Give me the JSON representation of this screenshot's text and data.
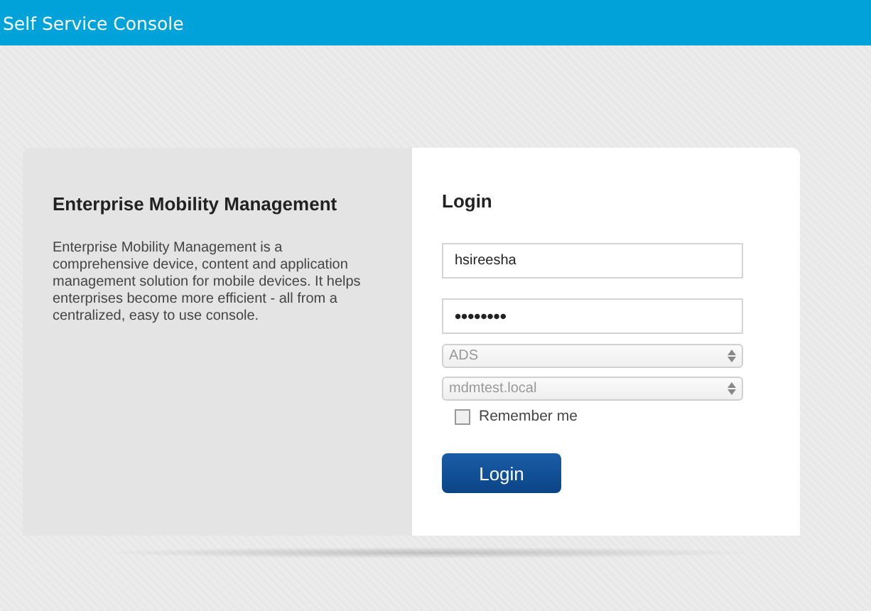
{
  "header": {
    "title": "Self Service Console"
  },
  "info": {
    "title": "Enterprise Mobility Management",
    "text": "Enterprise Mobility Management is a comprehensive device, content and application management solution for mobile devices. It helps enterprises become more efficient - all from a centralized, easy to use console."
  },
  "login": {
    "title": "Login",
    "fields": [
      {
        "kind": "text",
        "value": "hsireesha"
      },
      {
        "kind": "password",
        "value": "••••••••"
      },
      {
        "kind": "select",
        "value": "ADS"
      },
      {
        "kind": "select",
        "value": "mdmtest.local"
      }
    ],
    "remember": {
      "label": "Remember me",
      "checked": false
    },
    "button": "Login"
  }
}
